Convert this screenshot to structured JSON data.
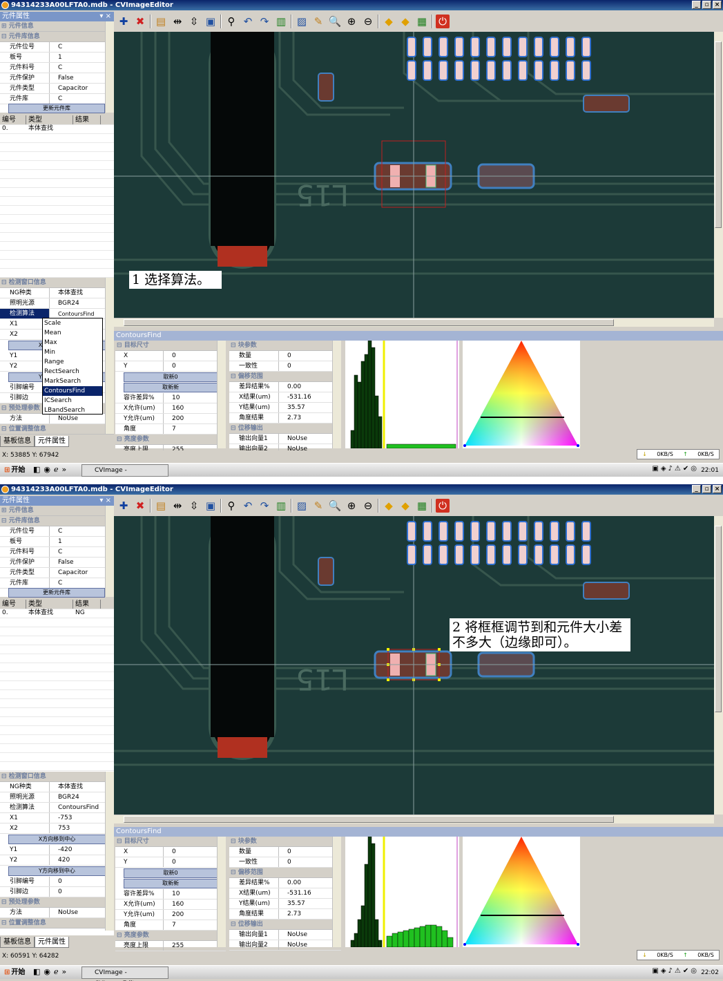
{
  "window1": {
    "title": "94314233A00LFTA0.mdb - CVImageEditor",
    "left_panel": {
      "caption": "元件属性",
      "groups": [
        {
          "label": "元件信息",
          "expanded": false
        },
        {
          "label": "元件库信息",
          "expanded": true
        }
      ],
      "properties": [
        {
          "key": "元件位号",
          "value": "C"
        },
        {
          "key": "板号",
          "value": "1"
        },
        {
          "key": "元件料号",
          "value": "C"
        },
        {
          "key": "元件保护",
          "value": "False"
        },
        {
          "key": "元件类型",
          "value": "Capacitor"
        },
        {
          "key": "元件库",
          "value": "C"
        }
      ],
      "lib_button": "更新元件库",
      "table_headers": [
        "编号",
        "类型",
        "结果"
      ],
      "table_rows": [
        {
          "id": "0.",
          "type": "本体查找",
          "result": ""
        }
      ],
      "detect_group": "检测窗口信息",
      "detect_props": [
        {
          "key": "NG种类",
          "value": "本体查找"
        },
        {
          "key": "照明光源",
          "value": "BGR24"
        },
        {
          "key": "检测算法",
          "value": "ContoursFind"
        },
        {
          "key": "X1",
          "value": ""
        },
        {
          "key": "X2",
          "value": ""
        },
        {
          "key": "Y1",
          "value": ""
        },
        {
          "key": "Y2",
          "value": ""
        },
        {
          "key": "引脚编号",
          "value": ""
        },
        {
          "key": "引脚边",
          "value": ""
        }
      ],
      "x_center_label": "X方向移到中心",
      "y_center_label": "Y方向移到中心",
      "pre_group": "预处理参数",
      "method_key": "方法",
      "method_value": "NoUse",
      "pos_group": "位置调整信息",
      "dropdown_options": [
        "Scale",
        "Mean",
        "Max",
        "Min",
        "Range",
        "RectSearch",
        "MarkSearch",
        "ContoursFind",
        "ICSearch",
        "LBandSearch"
      ],
      "dropdown_selected": "ContoursFind",
      "tabs": [
        "基板信息",
        "元件属性"
      ]
    },
    "annotation": "1 选择算法。",
    "image_label": "L15",
    "status_coords": "X: 53885 Y: 67942",
    "net_down": "0KB/S",
    "net_up": "0KB/S",
    "clock": "22:01"
  },
  "window2": {
    "title": "94314233A00LFTA0.mdb - CVImageEditor",
    "table_rows": [
      {
        "id": "0.",
        "type": "本体查找",
        "result": "NG"
      }
    ],
    "detect_props": [
      {
        "key": "NG种类",
        "value": "本体查找"
      },
      {
        "key": "照明光源",
        "value": "BGR24"
      },
      {
        "key": "检测算法",
        "value": "ContoursFind"
      },
      {
        "key": "X1",
        "value": "-753"
      },
      {
        "key": "X2",
        "value": "753"
      }
    ],
    "detect_props_y": [
      {
        "key": "Y1",
        "value": "-420"
      },
      {
        "key": "Y2",
        "value": "420"
      }
    ],
    "detect_props_pin": [
      {
        "key": "引脚编号",
        "value": "0"
      },
      {
        "key": "引脚边",
        "value": "0"
      }
    ],
    "annotation_line1": "2 将框框调节到和元件大小差",
    "annotation_line2": "不多大（边缘即可）。",
    "status_coords": "X: 60591 Y: 64282",
    "clock": "22:02"
  },
  "contours": {
    "caption": "ContoursFind",
    "target_group": "目标尺寸",
    "target_props": [
      {
        "key": "X",
        "value": "0"
      },
      {
        "key": "Y",
        "value": "0"
      }
    ],
    "btn_a": "取新0",
    "btn_b": "取新新",
    "tol_props": [
      {
        "key": "容许差异%",
        "value": "10"
      },
      {
        "key": "X允许(um)",
        "value": "160"
      },
      {
        "key": "Y允许(um)",
        "value": "200"
      },
      {
        "key": "角度",
        "value": "7"
      }
    ],
    "bright_group": "亮度参数",
    "bright_first": {
      "key": "亮度上限",
      "value": "255"
    },
    "block_group": "块参数",
    "block_props": [
      {
        "key": "数量",
        "value": "0"
      },
      {
        "key": "一致性",
        "value": "0"
      }
    ],
    "offset_group": "偏移范围",
    "offset_props": [
      {
        "key": "差异结果%",
        "value": "0.00"
      },
      {
        "key": "X结果(um)",
        "value": "-531.16"
      },
      {
        "key": "Y结果(um)",
        "value": "35.57"
      },
      {
        "key": "角度结果",
        "value": "2.73"
      }
    ],
    "output_group": "位移输出",
    "output_props": [
      {
        "key": "输出向量1",
        "value": "NoUse"
      },
      {
        "key": "输出向量2",
        "value": "NoUse"
      }
    ]
  },
  "taskbar": {
    "start": "开始",
    "task_label": "CVImage - CVImageEditor"
  }
}
